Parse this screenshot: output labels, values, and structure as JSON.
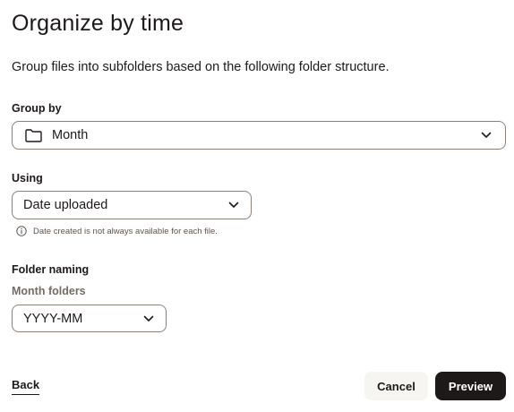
{
  "dialog": {
    "title": "Organize by time",
    "description": "Group files into subfolders based on the following folder structure."
  },
  "group_by": {
    "label": "Group by",
    "selected": "Month",
    "icon": "folder-icon"
  },
  "using": {
    "label": "Using",
    "selected": "Date uploaded",
    "hint": "Date created is not always available for each file.",
    "hint_icon": "info-icon"
  },
  "folder_naming": {
    "label": "Folder naming",
    "sublabel": "Month folders",
    "selected": "YYYY-MM"
  },
  "footer": {
    "back_label": "Back",
    "cancel_label": "Cancel",
    "preview_label": "Preview"
  },
  "colors": {
    "primary_button": "#1e1919",
    "secondary_button": "#f7f5f2",
    "border": "#8a8178",
    "muted_text": "#736c64"
  }
}
